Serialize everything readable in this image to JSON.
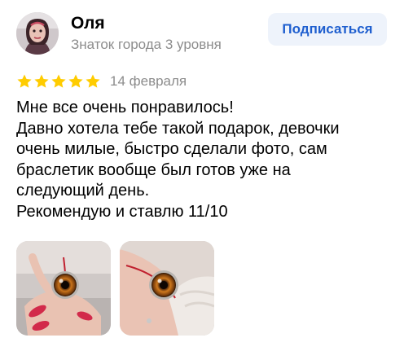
{
  "author": {
    "name": "Оля",
    "level": "Знаток города 3 уровня",
    "avatar_icon": "user-avatar"
  },
  "subscribe_label": "Подписаться",
  "rating": {
    "stars": 5,
    "max": 5,
    "date": "14 февраля"
  },
  "review_lines": [
    "Мне все очень понравилось!",
    "Давно хотела тебе такой подарок, девочки",
    "очень милые, быстро сделали фото, сам",
    "браслетик вообще был готов уже на",
    "следующий день.",
    "Рекомендую и ставлю 11/10"
  ],
  "colors": {
    "star": "#FFCC00",
    "accent": "#1F5FCF",
    "muted": "#8C8C8C",
    "button_bg": "#EEF3FB"
  }
}
